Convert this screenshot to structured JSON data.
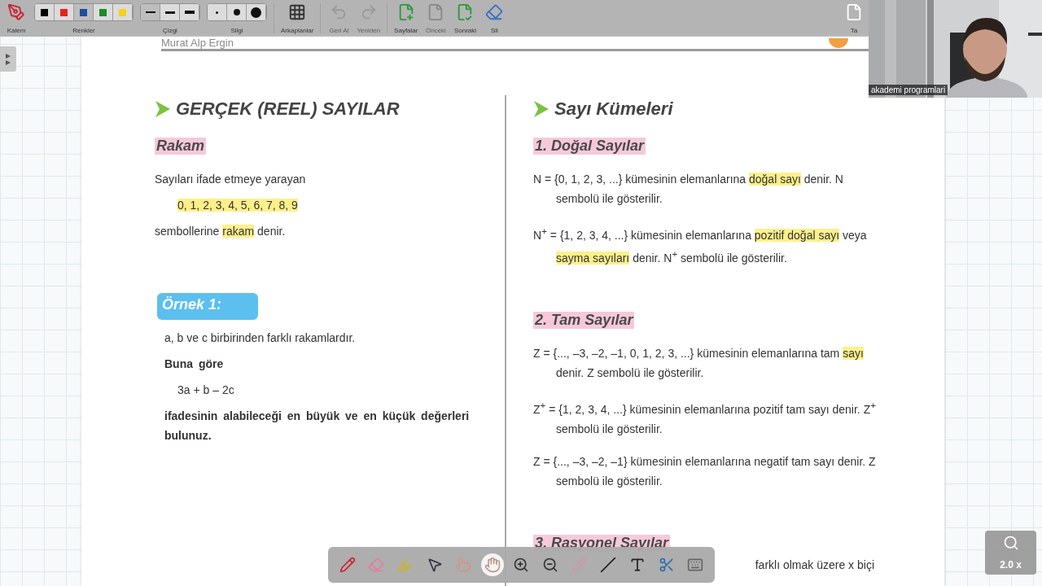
{
  "toolbar": {
    "items": [
      {
        "kind": "tool",
        "label": "Kalem",
        "disabled": false
      },
      {
        "kind": "swatches",
        "label": "Renkler",
        "options": [
          {
            "color": "#000000",
            "selected": false
          },
          {
            "color": "#e8231a",
            "selected": false
          },
          {
            "color": "#1d4f9c",
            "selected": true
          },
          {
            "color": "#1d8a25",
            "selected": false
          },
          {
            "color": "#f2d21b",
            "selected": false
          }
        ]
      },
      {
        "kind": "widths",
        "label": "Çizgi",
        "options": [
          {
            "selected": true
          },
          {
            "selected": false
          },
          {
            "selected": false
          }
        ]
      },
      {
        "kind": "dots",
        "label": "Silgi",
        "options": [
          {
            "selected": false
          },
          {
            "selected": false
          },
          {
            "selected": false
          }
        ]
      },
      {
        "kind": "tool",
        "label": "Arkaplanlar",
        "disabled": false
      },
      {
        "kind": "tool",
        "label": "Geri Al",
        "disabled": true
      },
      {
        "kind": "tool",
        "label": "Yeniden",
        "disabled": true
      },
      {
        "kind": "tool",
        "label": "Sayfalar",
        "disabled": false
      },
      {
        "kind": "tool",
        "label": "Önceki",
        "disabled": true
      },
      {
        "kind": "tool",
        "label": "Sonraki",
        "disabled": false
      },
      {
        "kind": "tool",
        "label": "Sil",
        "disabled": false
      },
      {
        "kind": "tool",
        "label": "Ta",
        "disabled": false
      }
    ]
  },
  "page_header": {
    "author": "Murat Alp Ergin"
  },
  "webcam": {
    "name": "akademi programlari"
  },
  "left_column": [
    {
      "kind": "heading",
      "segments": [
        {
          "text": "GERÇEK (REEL) SAYILAR",
          "highlighted": false
        }
      ]
    },
    {
      "kind": "subheading",
      "segments": [
        {
          "text": "Rakam",
          "highlighted": false
        }
      ]
    },
    {
      "kind": "text",
      "segments": [
        {
          "text": "Sayıları ifade etmeye yarayan",
          "highlighted": false
        }
      ]
    },
    {
      "kind": "formula",
      "segments": [
        {
          "text": "0, 1, 2, 3, 4, 5, 6, 7, 8, 9",
          "highlighted": true
        }
      ]
    },
    {
      "kind": "text",
      "segments": [
        {
          "text": "sembollerine ",
          "highlighted": false
        },
        {
          "text": "rakam",
          "highlighted": true
        },
        {
          "text": " denir.",
          "highlighted": false
        }
      ]
    },
    {
      "kind": "example",
      "segments": [
        {
          "text": "Örnek 1:",
          "highlighted": false
        }
      ]
    },
    {
      "kind": "question",
      "segments": [
        {
          "text": "a, b ve c birbirinden farklı rakamlardır.",
          "highlighted": false
        }
      ]
    },
    {
      "kind": "question-bold",
      "segments": [
        {
          "text": "Buna göre",
          "highlighted": false
        }
      ]
    },
    {
      "kind": "formula",
      "segments": [
        {
          "text": "3a + b – 2c",
          "highlighted": false
        }
      ]
    },
    {
      "kind": "question-bold",
      "segments": [
        {
          "text": "ifadesinin alabileceği en büyük ve en küçük değerleri bulunuz.",
          "highlighted": false
        }
      ]
    }
  ],
  "right_column": [
    {
      "kind": "heading",
      "segments": [
        {
          "text": "Sayı Kümeleri",
          "highlighted": false
        }
      ]
    },
    {
      "kind": "subheading",
      "segments": [
        {
          "text": "1.  Doğal Sayılar",
          "highlighted": false
        }
      ]
    },
    {
      "kind": "definition",
      "segments": [
        {
          "text": "N = {0, 1, 2, 3, ...} kümesinin elemanlarına ",
          "highlighted": false
        },
        {
          "text": "doğal sayı",
          "highlighted": true
        },
        {
          "text": " denir. N sembolü ile gösterilir.",
          "highlighted": false
        }
      ]
    },
    {
      "kind": "definition",
      "segments": [
        {
          "text": "N$^{+}$ = {1, 2, 3, 4, ...} kümesinin elemanlarına ",
          "highlighted": false
        },
        {
          "text": "pozitif doğal sayı",
          "highlighted": true
        },
        {
          "text": " veya ",
          "highlighted": false
        },
        {
          "text": "sayma sayıları",
          "highlighted": true
        },
        {
          "text": " denir. N$^{+}$ sembolü ile gösterilir.",
          "highlighted": false
        }
      ]
    },
    {
      "kind": "subheading",
      "segments": [
        {
          "text": "2.  Tam Sayılar",
          "highlighted": false
        }
      ]
    },
    {
      "kind": "definition",
      "segments": [
        {
          "text": "Z = {..., –3, –2, –1, 0, 1, 2, 3, ...} kümesinin elemanlarına tam ",
          "highlighted": false
        },
        {
          "text": "sayı",
          "highlighted": true
        },
        {
          "text": " denir. Z sembolü ile gösterilir.",
          "highlighted": false
        }
      ]
    },
    {
      "kind": "definition",
      "segments": [
        {
          "text": "Z$^{+}$ = {1, 2, 3, 4, ...} kümesinin elemanlarına pozitif tam sayı denir. Z$^{+}$ sembolü ile gösterilir.",
          "highlighted": false
        }
      ]
    },
    {
      "kind": "definition",
      "segments": [
        {
          "text": "Z = {..., –3, –2, –1} kümesinin elemanlarına negatif tam sayı denir. Z sembolü ile gösterilir.",
          "highlighted": false
        }
      ]
    },
    {
      "kind": "subheading",
      "segments": [
        {
          "text": "3.  Rasyonel Sayılar",
          "highlighted": false
        }
      ]
    },
    {
      "kind": "text-right",
      "segments": [
        {
          "text": "farklı olmak üzere  x  biçi",
          "highlighted": false
        }
      ]
    }
  ],
  "bottom_toolbar": {
    "tools": [
      {
        "selected": false
      },
      {
        "selected": false
      },
      {
        "selected": false
      },
      {
        "selected": false
      },
      {
        "selected": false
      },
      {
        "selected": true
      },
      {
        "selected": false
      },
      {
        "selected": false
      },
      {
        "selected": false
      },
      {
        "selected": false
      },
      {
        "selected": false
      },
      {
        "selected": false
      },
      {
        "selected": false
      }
    ]
  },
  "zoom_indicator": {
    "label": "2.0 x"
  }
}
